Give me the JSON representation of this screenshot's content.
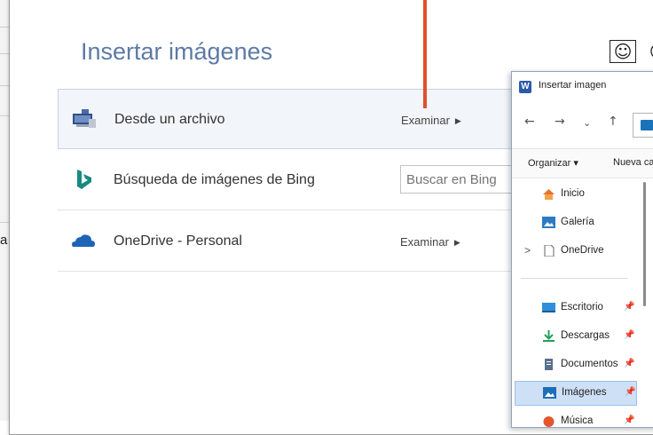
{
  "background": {
    "partial_letter": "a"
  },
  "dialog": {
    "title": "Insertar imágenes",
    "close_glyph": "×",
    "feedback_happy": "☺",
    "feedback_sad": "☹",
    "rows": [
      {
        "label": "Desde un archivo",
        "action": "Examinar"
      },
      {
        "label": "Búsqueda de imágenes de Bing",
        "search_placeholder": "Buscar en Bing"
      },
      {
        "label": "OneDrive - Personal",
        "action": "Examinar"
      }
    ]
  },
  "picker": {
    "title": "Insertar imagen",
    "nav": {
      "back": "←",
      "forward": "→",
      "dropdown": "⌄",
      "up": "↑"
    },
    "toolbar": {
      "organize": "Organizar ▾",
      "new_folder": "Nueva ca"
    },
    "tree": [
      {
        "label": "Inicio",
        "icon": "home-icon"
      },
      {
        "label": "Galería",
        "icon": "gallery-icon"
      },
      {
        "label": "OneDrive",
        "icon": "file-icon",
        "expander": ">"
      },
      {
        "label": "Escritorio",
        "icon": "desktop-icon",
        "pinned": true
      },
      {
        "label": "Descargas",
        "icon": "download-icon",
        "pinned": true
      },
      {
        "label": "Documentos",
        "icon": "documents-icon",
        "pinned": true
      },
      {
        "label": "Imágenes",
        "icon": "pictures-icon",
        "pinned": true,
        "selected": true
      },
      {
        "label": "Música",
        "icon": "music-icon",
        "pinned": true
      }
    ]
  },
  "colors": {
    "title": "#5d7aa6",
    "bing": "#178a84",
    "onedrive": "#1e63b5",
    "pointer": "#e0502d",
    "selection": "#cde0f5"
  }
}
